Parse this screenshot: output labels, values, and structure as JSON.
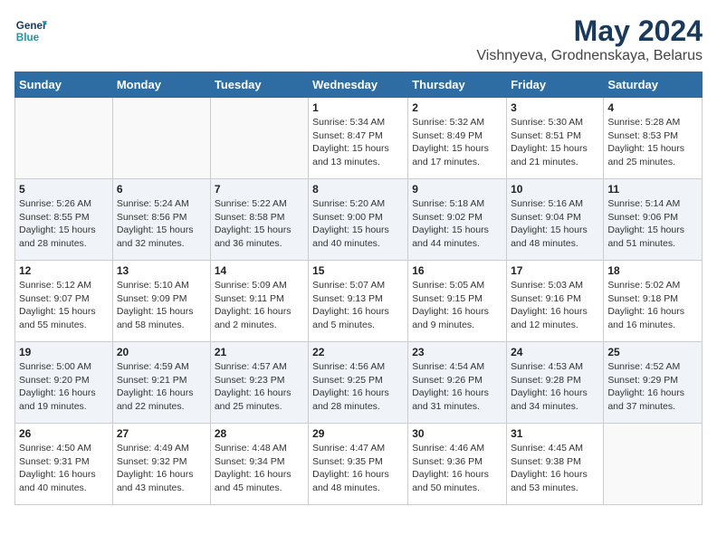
{
  "header": {
    "logo_line1": "General",
    "logo_line2": "Blue",
    "month_year": "May 2024",
    "location": "Vishnyeva, Grodnenskaya, Belarus"
  },
  "weekdays": [
    "Sunday",
    "Monday",
    "Tuesday",
    "Wednesday",
    "Thursday",
    "Friday",
    "Saturday"
  ],
  "weeks": [
    [
      {
        "day": "",
        "info": ""
      },
      {
        "day": "",
        "info": ""
      },
      {
        "day": "",
        "info": ""
      },
      {
        "day": "1",
        "info": "Sunrise: 5:34 AM\nSunset: 8:47 PM\nDaylight: 15 hours\nand 13 minutes."
      },
      {
        "day": "2",
        "info": "Sunrise: 5:32 AM\nSunset: 8:49 PM\nDaylight: 15 hours\nand 17 minutes."
      },
      {
        "day": "3",
        "info": "Sunrise: 5:30 AM\nSunset: 8:51 PM\nDaylight: 15 hours\nand 21 minutes."
      },
      {
        "day": "4",
        "info": "Sunrise: 5:28 AM\nSunset: 8:53 PM\nDaylight: 15 hours\nand 25 minutes."
      }
    ],
    [
      {
        "day": "5",
        "info": "Sunrise: 5:26 AM\nSunset: 8:55 PM\nDaylight: 15 hours\nand 28 minutes."
      },
      {
        "day": "6",
        "info": "Sunrise: 5:24 AM\nSunset: 8:56 PM\nDaylight: 15 hours\nand 32 minutes."
      },
      {
        "day": "7",
        "info": "Sunrise: 5:22 AM\nSunset: 8:58 PM\nDaylight: 15 hours\nand 36 minutes."
      },
      {
        "day": "8",
        "info": "Sunrise: 5:20 AM\nSunset: 9:00 PM\nDaylight: 15 hours\nand 40 minutes."
      },
      {
        "day": "9",
        "info": "Sunrise: 5:18 AM\nSunset: 9:02 PM\nDaylight: 15 hours\nand 44 minutes."
      },
      {
        "day": "10",
        "info": "Sunrise: 5:16 AM\nSunset: 9:04 PM\nDaylight: 15 hours\nand 48 minutes."
      },
      {
        "day": "11",
        "info": "Sunrise: 5:14 AM\nSunset: 9:06 PM\nDaylight: 15 hours\nand 51 minutes."
      }
    ],
    [
      {
        "day": "12",
        "info": "Sunrise: 5:12 AM\nSunset: 9:07 PM\nDaylight: 15 hours\nand 55 minutes."
      },
      {
        "day": "13",
        "info": "Sunrise: 5:10 AM\nSunset: 9:09 PM\nDaylight: 15 hours\nand 58 minutes."
      },
      {
        "day": "14",
        "info": "Sunrise: 5:09 AM\nSunset: 9:11 PM\nDaylight: 16 hours\nand 2 minutes."
      },
      {
        "day": "15",
        "info": "Sunrise: 5:07 AM\nSunset: 9:13 PM\nDaylight: 16 hours\nand 5 minutes."
      },
      {
        "day": "16",
        "info": "Sunrise: 5:05 AM\nSunset: 9:15 PM\nDaylight: 16 hours\nand 9 minutes."
      },
      {
        "day": "17",
        "info": "Sunrise: 5:03 AM\nSunset: 9:16 PM\nDaylight: 16 hours\nand 12 minutes."
      },
      {
        "day": "18",
        "info": "Sunrise: 5:02 AM\nSunset: 9:18 PM\nDaylight: 16 hours\nand 16 minutes."
      }
    ],
    [
      {
        "day": "19",
        "info": "Sunrise: 5:00 AM\nSunset: 9:20 PM\nDaylight: 16 hours\nand 19 minutes."
      },
      {
        "day": "20",
        "info": "Sunrise: 4:59 AM\nSunset: 9:21 PM\nDaylight: 16 hours\nand 22 minutes."
      },
      {
        "day": "21",
        "info": "Sunrise: 4:57 AM\nSunset: 9:23 PM\nDaylight: 16 hours\nand 25 minutes."
      },
      {
        "day": "22",
        "info": "Sunrise: 4:56 AM\nSunset: 9:25 PM\nDaylight: 16 hours\nand 28 minutes."
      },
      {
        "day": "23",
        "info": "Sunrise: 4:54 AM\nSunset: 9:26 PM\nDaylight: 16 hours\nand 31 minutes."
      },
      {
        "day": "24",
        "info": "Sunrise: 4:53 AM\nSunset: 9:28 PM\nDaylight: 16 hours\nand 34 minutes."
      },
      {
        "day": "25",
        "info": "Sunrise: 4:52 AM\nSunset: 9:29 PM\nDaylight: 16 hours\nand 37 minutes."
      }
    ],
    [
      {
        "day": "26",
        "info": "Sunrise: 4:50 AM\nSunset: 9:31 PM\nDaylight: 16 hours\nand 40 minutes."
      },
      {
        "day": "27",
        "info": "Sunrise: 4:49 AM\nSunset: 9:32 PM\nDaylight: 16 hours\nand 43 minutes."
      },
      {
        "day": "28",
        "info": "Sunrise: 4:48 AM\nSunset: 9:34 PM\nDaylight: 16 hours\nand 45 minutes."
      },
      {
        "day": "29",
        "info": "Sunrise: 4:47 AM\nSunset: 9:35 PM\nDaylight: 16 hours\nand 48 minutes."
      },
      {
        "day": "30",
        "info": "Sunrise: 4:46 AM\nSunset: 9:36 PM\nDaylight: 16 hours\nand 50 minutes."
      },
      {
        "day": "31",
        "info": "Sunrise: 4:45 AM\nSunset: 9:38 PM\nDaylight: 16 hours\nand 53 minutes."
      },
      {
        "day": "",
        "info": ""
      }
    ]
  ]
}
